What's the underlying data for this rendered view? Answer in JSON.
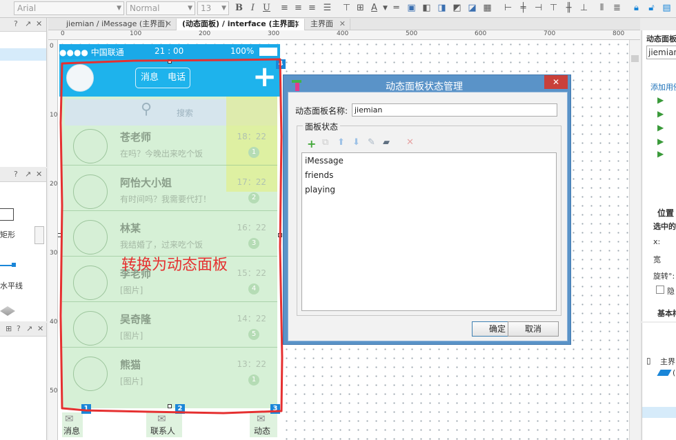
{
  "toolbar": {
    "font_family": "Arial",
    "font_style": "Normal",
    "font_size": "13"
  },
  "tabs": [
    {
      "label": "jiemian / iMessage (主界面)"
    },
    {
      "label": "(动态面板) / interface (主界面)"
    },
    {
      "label": "主界面"
    }
  ],
  "ruler": {
    "top": [
      "0",
      "100",
      "200",
      "300",
      "400",
      "500",
      "600",
      "700",
      "800"
    ],
    "left": [
      "0",
      "100",
      "200",
      "300",
      "400",
      "500"
    ]
  },
  "left_panels": {
    "shape_label": "矩形",
    "line_label": "水平线"
  },
  "right_panel": {
    "title": "动态面板",
    "name_value": "jiemian",
    "add_use_case": "添加用例",
    "position_header": "位置",
    "selected_label": "选中的",
    "x_label": "x:",
    "width_label": "宽",
    "rotation_label": "旋转°:",
    "hide_label": "隐",
    "basic_label": "基本样",
    "outline_root": "主界",
    "outline_child": "("
  },
  "phone": {
    "carrier": "●●●● 中国联通",
    "time": "21 : 00",
    "battery": "100%",
    "tab_messages": "消息",
    "tab_phone": "电话",
    "plus": "+",
    "search_placeholder": "搜索",
    "overlay_text": "转换为动态面板",
    "contacts": [
      {
        "name": "苍老师",
        "message": "在吗？今晚出来吃个饭",
        "time": "18：22",
        "badge": "1"
      },
      {
        "name": "阿怡大小姐",
        "message": "有时间吗？我需要代打！",
        "time": "17：22",
        "badge": "2"
      },
      {
        "name": "林某",
        "message": "我结婚了，过来吃个饭",
        "time": "16：22",
        "badge": "3"
      },
      {
        "name": "李老师",
        "message": "[图片]",
        "time": "15：22",
        "badge": "4"
      },
      {
        "name": "吴奇隆",
        "message": "[图片]",
        "time": "14：22",
        "badge": "5"
      },
      {
        "name": "熊猫",
        "message": "[图片]",
        "time": "13：22",
        "badge": "1"
      }
    ],
    "bottom_tabs": [
      "消息",
      "联系人",
      "动态"
    ],
    "markers": [
      "1",
      "2",
      "3",
      "4"
    ]
  },
  "dialog": {
    "title": "动态面板状态管理",
    "name_label": "动态面板名称:",
    "name_value": "jiemian",
    "group_label": "面板状态",
    "states": [
      "iMessage",
      "friends",
      "playing"
    ],
    "ok_label": "确定",
    "cancel_label": "取消",
    "close_glyph": "✕"
  },
  "colors": {
    "accent_blue": "#1eb3ec",
    "dialog_blue": "#5a93c8",
    "annotation_red": "#e53030",
    "close_red": "#c9403a"
  }
}
